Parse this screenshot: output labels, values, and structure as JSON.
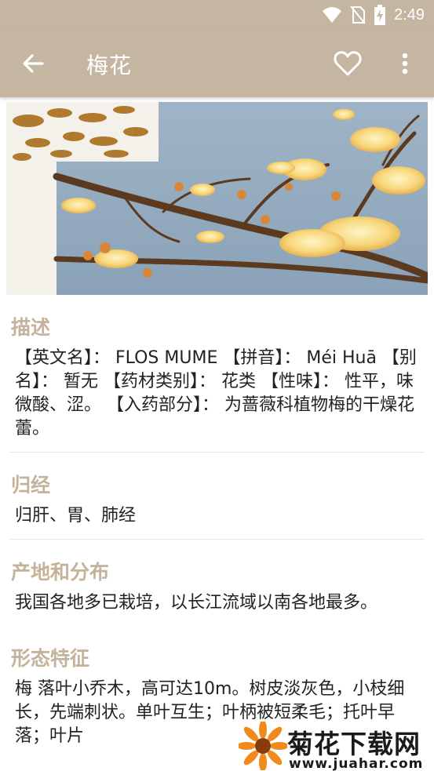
{
  "status_bar": {
    "time": "2:49",
    "icons": [
      "wifi-icon",
      "no-sim-icon",
      "battery-charging-icon"
    ]
  },
  "app_bar": {
    "title": "梅花",
    "back_icon": "arrow-back-icon",
    "favorite_icon": "heart-outline-icon",
    "more_icon": "more-vertical-icon"
  },
  "colors": {
    "app_bar": "#c4b6a0",
    "section_title": "#c4b29a",
    "body_text": "#222222"
  },
  "sections": [
    {
      "title": "描述",
      "body": "【英文名】： FLOS MUME 【拼音】： Méi Huā 【别名】： 暂无 【药材类别】： 花类 【性味】： 性平，味微酸、涩。 【入药部分】： 为蔷薇科植物梅的干燥花蕾。"
    },
    {
      "title": "归经",
      "body": "归肝、胃、肺经"
    },
    {
      "title": "产地和分布",
      "body": "我国各地多已栽培，以长江流域以南各地最多。"
    },
    {
      "title": "形态特征",
      "body": "梅 落叶小乔木，高可达10m。树皮淡灰色，小枝细长，先端刺状。单叶互生；叶柄被短柔毛；托叶早落；叶片"
    }
  ],
  "watermark": {
    "brand": "菊花下载网",
    "url": "www.juahar.com"
  }
}
